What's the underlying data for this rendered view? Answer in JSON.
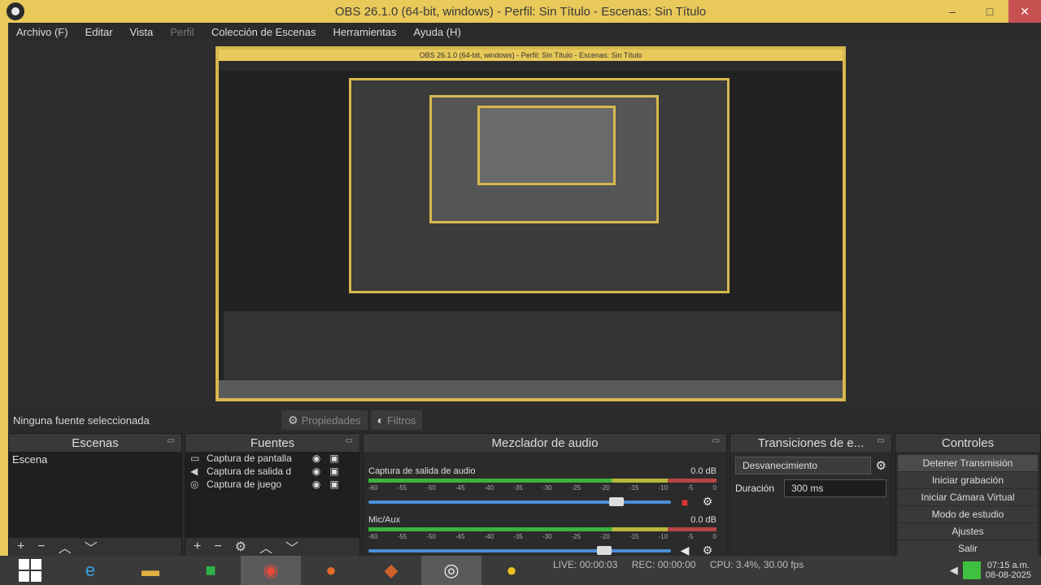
{
  "window": {
    "title": "OBS 26.1.0 (64-bit, windows) - Perfil: Sin Título - Escenas: Sin Título",
    "minimize": "–",
    "maximize": "□",
    "close": "✕"
  },
  "menu": {
    "items": [
      "Archivo (F)",
      "Editar",
      "Vista",
      "Perfil",
      "Colección de Escenas",
      "Herramientas",
      "Ayuda (H)"
    ]
  },
  "nested_preview": {
    "title": "OBS 26.1.0 (64-bit, windows) - Perfil: Sin Título - Escenas: Sin Título"
  },
  "source_toolbar": {
    "no_source": "Ninguna fuente seleccionada",
    "properties": "Propiedades",
    "filters": "Filtros"
  },
  "scenes": {
    "header": "Escenas",
    "items": [
      "Escena"
    ]
  },
  "sources": {
    "header": "Fuentes",
    "items": [
      {
        "icon": "monitor-icon",
        "name": "Captura de pantalla"
      },
      {
        "icon": "speaker-icon",
        "name": "Captura de salida d"
      },
      {
        "icon": "gamepad-icon",
        "name": "Captura de juego"
      }
    ]
  },
  "mixer": {
    "header": "Mezclador de audio",
    "channels": [
      {
        "name": "Captura de salida de audio",
        "db": "0.0 dB",
        "volume": 0.82,
        "muted": true
      },
      {
        "name": "Mic/Aux",
        "db": "0.0 dB",
        "volume": 0.78,
        "muted": false
      }
    ],
    "ticks": [
      "-60",
      "-55",
      "-50",
      "-45",
      "-40",
      "-35",
      "-30",
      "-25",
      "-20",
      "-15",
      "-10",
      "-5",
      "0"
    ]
  },
  "transitions": {
    "header": "Transiciones de e...",
    "selected": "Desvanecimiento",
    "duration_label": "Duración",
    "duration_value": "300 ms"
  },
  "controls": {
    "header": "Controles",
    "buttons": [
      "Detener Transmisión",
      "Iniciar grabación",
      "Iniciar Cámara Virtual",
      "Modo de estudio",
      "Ajustes",
      "Salir"
    ]
  },
  "status": {
    "live": "LIVE: 00:00:03",
    "rec": "REC: 00:00:00",
    "cpu": "CPU: 3.4%, 30.00 fps"
  },
  "clock": {
    "time": "07:15 a.m.",
    "date": "08-08-2025"
  },
  "colors": {
    "titlebar": "#e8c95a",
    "panel": "#2b2b2b",
    "meter_green": "#3bb33b",
    "meter_red": "#b84444",
    "slider": "#4a90d9"
  }
}
